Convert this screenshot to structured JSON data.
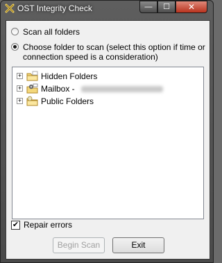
{
  "window": {
    "title": "OST Integrity Check",
    "controls": {
      "minimize": "—",
      "maximize": "☐",
      "close": "✕"
    }
  },
  "options": {
    "scan_all_label": "Scan all folders",
    "scan_all_selected": false,
    "choose_folder_label": "Choose folder to scan (select this option if time or connection speed is a consideration)",
    "choose_folder_selected": true
  },
  "tree": {
    "items": [
      {
        "label": "Hidden Folders",
        "icon": "folder-icon",
        "expander": "+"
      },
      {
        "label": "Mailbox - ",
        "icon": "mailbox-icon",
        "expander": "+"
      },
      {
        "label": "Public Folders",
        "icon": "public-folder-icon",
        "expander": "+"
      }
    ]
  },
  "repair": {
    "label": "Repair errors",
    "checked": true,
    "checkmark": "✔"
  },
  "buttons": {
    "begin_scan": "Begin Scan",
    "exit": "Exit"
  }
}
